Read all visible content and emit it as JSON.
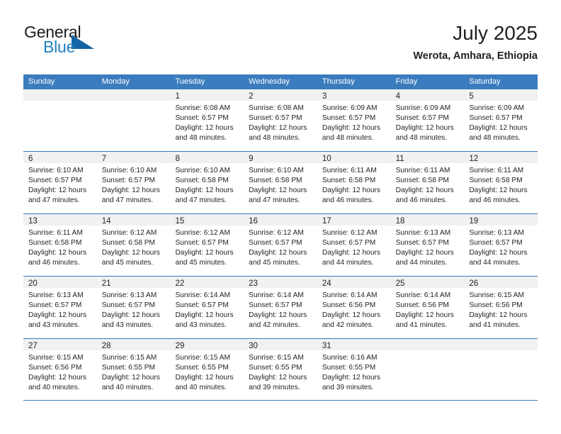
{
  "brand": {
    "name_top": "General",
    "name_bottom": "Blue",
    "accent_color": "#1464a5",
    "text_color": "#1a1a1a",
    "blue_text_color": "#1f7fc4"
  },
  "header": {
    "title": "July 2025",
    "subtitle": "Werota, Amhara, Ethiopia"
  },
  "theme": {
    "header_bg": "#3a7cbe",
    "header_text": "#ffffff",
    "daynum_band_bg": "#f1f1f1",
    "grid_line": "#3a7cbe",
    "body_text": "#231f20"
  },
  "weekdays": [
    "Sunday",
    "Monday",
    "Tuesday",
    "Wednesday",
    "Thursday",
    "Friday",
    "Saturday"
  ],
  "weeks": [
    [
      {
        "day": "",
        "lines": []
      },
      {
        "day": "",
        "lines": []
      },
      {
        "day": "1",
        "lines": [
          "Sunrise: 6:08 AM",
          "Sunset: 6:57 PM",
          "Daylight: 12 hours",
          "and 48 minutes."
        ]
      },
      {
        "day": "2",
        "lines": [
          "Sunrise: 6:08 AM",
          "Sunset: 6:57 PM",
          "Daylight: 12 hours",
          "and 48 minutes."
        ]
      },
      {
        "day": "3",
        "lines": [
          "Sunrise: 6:09 AM",
          "Sunset: 6:57 PM",
          "Daylight: 12 hours",
          "and 48 minutes."
        ]
      },
      {
        "day": "4",
        "lines": [
          "Sunrise: 6:09 AM",
          "Sunset: 6:57 PM",
          "Daylight: 12 hours",
          "and 48 minutes."
        ]
      },
      {
        "day": "5",
        "lines": [
          "Sunrise: 6:09 AM",
          "Sunset: 6:57 PM",
          "Daylight: 12 hours",
          "and 48 minutes."
        ]
      }
    ],
    [
      {
        "day": "6",
        "lines": [
          "Sunrise: 6:10 AM",
          "Sunset: 6:57 PM",
          "Daylight: 12 hours",
          "and 47 minutes."
        ]
      },
      {
        "day": "7",
        "lines": [
          "Sunrise: 6:10 AM",
          "Sunset: 6:57 PM",
          "Daylight: 12 hours",
          "and 47 minutes."
        ]
      },
      {
        "day": "8",
        "lines": [
          "Sunrise: 6:10 AM",
          "Sunset: 6:58 PM",
          "Daylight: 12 hours",
          "and 47 minutes."
        ]
      },
      {
        "day": "9",
        "lines": [
          "Sunrise: 6:10 AM",
          "Sunset: 6:58 PM",
          "Daylight: 12 hours",
          "and 47 minutes."
        ]
      },
      {
        "day": "10",
        "lines": [
          "Sunrise: 6:11 AM",
          "Sunset: 6:58 PM",
          "Daylight: 12 hours",
          "and 46 minutes."
        ]
      },
      {
        "day": "11",
        "lines": [
          "Sunrise: 6:11 AM",
          "Sunset: 6:58 PM",
          "Daylight: 12 hours",
          "and 46 minutes."
        ]
      },
      {
        "day": "12",
        "lines": [
          "Sunrise: 6:11 AM",
          "Sunset: 6:58 PM",
          "Daylight: 12 hours",
          "and 46 minutes."
        ]
      }
    ],
    [
      {
        "day": "13",
        "lines": [
          "Sunrise: 6:11 AM",
          "Sunset: 6:58 PM",
          "Daylight: 12 hours",
          "and 46 minutes."
        ]
      },
      {
        "day": "14",
        "lines": [
          "Sunrise: 6:12 AM",
          "Sunset: 6:58 PM",
          "Daylight: 12 hours",
          "and 45 minutes."
        ]
      },
      {
        "day": "15",
        "lines": [
          "Sunrise: 6:12 AM",
          "Sunset: 6:57 PM",
          "Daylight: 12 hours",
          "and 45 minutes."
        ]
      },
      {
        "day": "16",
        "lines": [
          "Sunrise: 6:12 AM",
          "Sunset: 6:57 PM",
          "Daylight: 12 hours",
          "and 45 minutes."
        ]
      },
      {
        "day": "17",
        "lines": [
          "Sunrise: 6:12 AM",
          "Sunset: 6:57 PM",
          "Daylight: 12 hours",
          "and 44 minutes."
        ]
      },
      {
        "day": "18",
        "lines": [
          "Sunrise: 6:13 AM",
          "Sunset: 6:57 PM",
          "Daylight: 12 hours",
          "and 44 minutes."
        ]
      },
      {
        "day": "19",
        "lines": [
          "Sunrise: 6:13 AM",
          "Sunset: 6:57 PM",
          "Daylight: 12 hours",
          "and 44 minutes."
        ]
      }
    ],
    [
      {
        "day": "20",
        "lines": [
          "Sunrise: 6:13 AM",
          "Sunset: 6:57 PM",
          "Daylight: 12 hours",
          "and 43 minutes."
        ]
      },
      {
        "day": "21",
        "lines": [
          "Sunrise: 6:13 AM",
          "Sunset: 6:57 PM",
          "Daylight: 12 hours",
          "and 43 minutes."
        ]
      },
      {
        "day": "22",
        "lines": [
          "Sunrise: 6:14 AM",
          "Sunset: 6:57 PM",
          "Daylight: 12 hours",
          "and 43 minutes."
        ]
      },
      {
        "day": "23",
        "lines": [
          "Sunrise: 6:14 AM",
          "Sunset: 6:57 PM",
          "Daylight: 12 hours",
          "and 42 minutes."
        ]
      },
      {
        "day": "24",
        "lines": [
          "Sunrise: 6:14 AM",
          "Sunset: 6:56 PM",
          "Daylight: 12 hours",
          "and 42 minutes."
        ]
      },
      {
        "day": "25",
        "lines": [
          "Sunrise: 6:14 AM",
          "Sunset: 6:56 PM",
          "Daylight: 12 hours",
          "and 41 minutes."
        ]
      },
      {
        "day": "26",
        "lines": [
          "Sunrise: 6:15 AM",
          "Sunset: 6:56 PM",
          "Daylight: 12 hours",
          "and 41 minutes."
        ]
      }
    ],
    [
      {
        "day": "27",
        "lines": [
          "Sunrise: 6:15 AM",
          "Sunset: 6:56 PM",
          "Daylight: 12 hours",
          "and 40 minutes."
        ]
      },
      {
        "day": "28",
        "lines": [
          "Sunrise: 6:15 AM",
          "Sunset: 6:55 PM",
          "Daylight: 12 hours",
          "and 40 minutes."
        ]
      },
      {
        "day": "29",
        "lines": [
          "Sunrise: 6:15 AM",
          "Sunset: 6:55 PM",
          "Daylight: 12 hours",
          "and 40 minutes."
        ]
      },
      {
        "day": "30",
        "lines": [
          "Sunrise: 6:15 AM",
          "Sunset: 6:55 PM",
          "Daylight: 12 hours",
          "and 39 minutes."
        ]
      },
      {
        "day": "31",
        "lines": [
          "Sunrise: 6:16 AM",
          "Sunset: 6:55 PM",
          "Daylight: 12 hours",
          "and 39 minutes."
        ]
      },
      {
        "day": "",
        "lines": []
      },
      {
        "day": "",
        "lines": []
      }
    ]
  ]
}
